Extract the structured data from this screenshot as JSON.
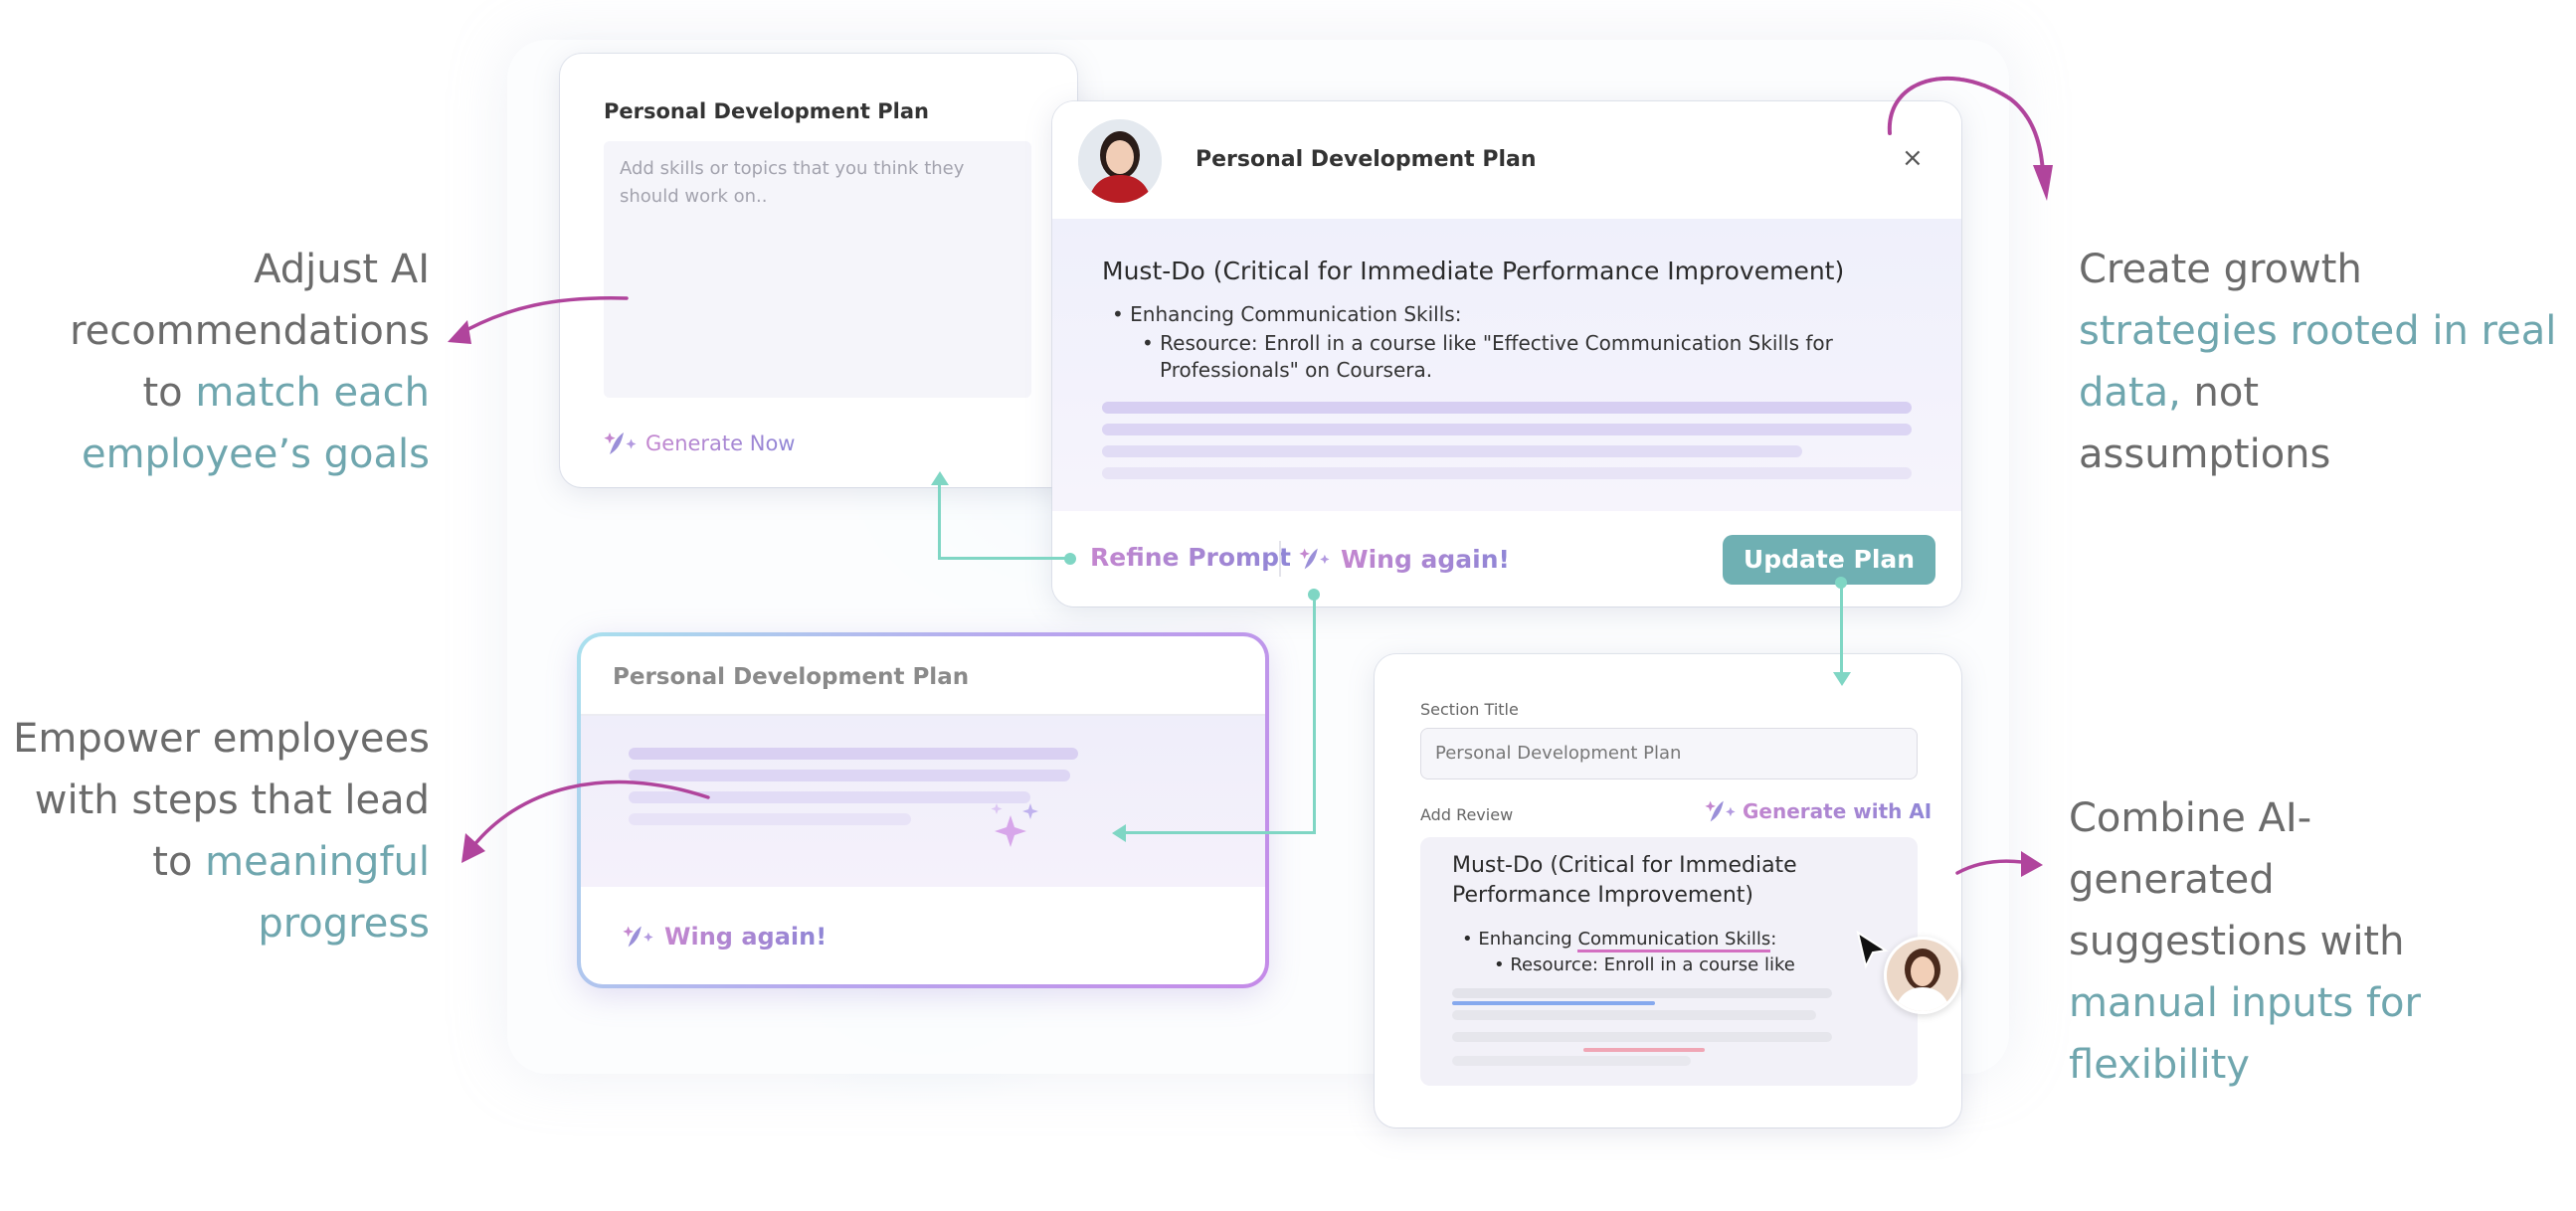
{
  "colors": {
    "teal_accent": "#6fa6ae",
    "update_button": "#6fb0b3",
    "connector": "#7fd6c4",
    "arrow": "#b0449c",
    "gradient_pink": "#c486cf",
    "gradient_purple": "#8f86d6"
  },
  "card_generate": {
    "title": "Personal Development Plan",
    "textarea_placeholder": "Add skills or topics that you think they should work on..",
    "generate_label": "Generate Now"
  },
  "card_plan": {
    "title": "Personal Development Plan",
    "close_label": "×",
    "heading": "Must-Do (Critical for Immediate Performance Improvement)",
    "bullet_1": "Enhancing Communication Skills:",
    "bullet_1_sub_line1": "Resource: Enroll in a course like \"Effective Communication Skills for",
    "bullet_1_sub_line2": "Professionals\" on Coursera.",
    "refine_label": "Refine Prompt",
    "wing_label": "Wing again!",
    "update_label": "Update Plan"
  },
  "card_loading": {
    "title": "Personal Development Plan",
    "wing_label": "Wing again!"
  },
  "card_edit": {
    "section_title_label": "Section Title",
    "section_title_value": "Personal Development Plan",
    "add_review_label": "Add Review",
    "generate_ai_label": "Generate with AI",
    "heading_line1": "Must-Do (Critical for Immediate",
    "heading_line2": "Performance Improvement)",
    "bullet_1_prefix": "Enhancing ",
    "bullet_1_highlight": "Communication Skills",
    "bullet_1_suffix": ":",
    "bullet_1_sub": "Resource: Enroll in a course like"
  },
  "left_text_1": {
    "line1": "Adjust AI",
    "line2": "recommendations",
    "line3_plain": "to ",
    "line3_accent": "match each",
    "line4_accent": "employee’s goals"
  },
  "left_text_2": {
    "line1": "Empower employees",
    "line2": "with steps that lead",
    "line3_plain": "to ",
    "line3_accent": "meaningful",
    "line4_accent": "progress"
  },
  "right_text_1": {
    "line1": "Create growth",
    "line2_accent": "strategies rooted in real",
    "line3_accent": "data,",
    "line3_plain": " not",
    "line4": "assumptions"
  },
  "right_text_2": {
    "line1": "Combine AI-",
    "line2": "generated",
    "line3": "suggestions with",
    "line4_accent": "manual inputs for",
    "line5_accent": "flexibility"
  }
}
